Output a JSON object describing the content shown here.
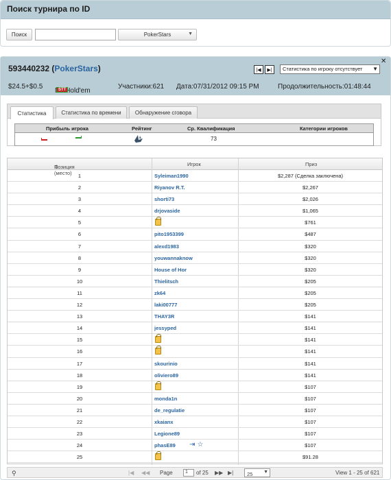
{
  "search": {
    "title": "Поиск турнира по ID",
    "button_label": "Поиск",
    "input_value": "",
    "room_select": "PokerStars"
  },
  "tournament": {
    "id": "593440232",
    "room": "PokerStars",
    "buyin": "$24.5+$0.5",
    "game": "NL Hold'em",
    "game_badge": "STT",
    "participants": "Участники:621",
    "date": "Дата:07/31/2012 09:15 PM",
    "duration": "Продолжительность:01:48:44",
    "stats_select": "Статистика по игроку отсутствует",
    "nav_prev": "|◀",
    "nav_next": "▶|",
    "close": "✕"
  },
  "tabs": [
    "Статистика",
    "Статистика по времени",
    "Обнаружение сговора"
  ],
  "stats": {
    "headers": [
      "Прибыль игрока",
      "Рейтинг",
      "Ср. Квалификация",
      "Категории игроков"
    ],
    "avg_qualification": "73"
  },
  "grid": {
    "headers": {
      "position": "Позиция (место)",
      "sort_icon": "⇕",
      "player": "Игрок",
      "prize": "Приз"
    },
    "rows": [
      {
        "pos": "1",
        "player": "Syleiman1990",
        "prize": "$2,287 (Сделка заключена)"
      },
      {
        "pos": "2",
        "player": "Riyanov R.T.",
        "prize": "$2,267"
      },
      {
        "pos": "3",
        "player": "shorti73",
        "prize": "$2,026"
      },
      {
        "pos": "4",
        "player": "drjovaside",
        "prize": "$1,065"
      },
      {
        "pos": "5",
        "player": "",
        "prize": "$761"
      },
      {
        "pos": "6",
        "player": "pito1953399",
        "prize": "$487"
      },
      {
        "pos": "7",
        "player": "alexd1983",
        "prize": "$320"
      },
      {
        "pos": "8",
        "player": "youwannaknow",
        "prize": "$320"
      },
      {
        "pos": "9",
        "player": "House of Hor",
        "prize": "$320"
      },
      {
        "pos": "10",
        "player": "Thielitsch",
        "prize": "$205"
      },
      {
        "pos": "11",
        "player": "zk64",
        "prize": "$205"
      },
      {
        "pos": "12",
        "player": "laki00777",
        "prize": "$205"
      },
      {
        "pos": "13",
        "player": "THAY3R",
        "prize": "$141"
      },
      {
        "pos": "14",
        "player": "jessyped",
        "prize": "$141"
      },
      {
        "pos": "15",
        "player": "",
        "prize": "$141"
      },
      {
        "pos": "16",
        "player": "",
        "prize": "$141"
      },
      {
        "pos": "17",
        "player": "skourinio",
        "prize": "$141"
      },
      {
        "pos": "18",
        "player": "oliviero89",
        "prize": "$141"
      },
      {
        "pos": "19",
        "player": "",
        "prize": "$107"
      },
      {
        "pos": "20",
        "player": "monda1n",
        "prize": "$107"
      },
      {
        "pos": "21",
        "player": "de_regulatie",
        "prize": "$107"
      },
      {
        "pos": "22",
        "player": "xkaianx",
        "prize": "$107"
      },
      {
        "pos": "23",
        "player": "Legione89",
        "prize": "$107"
      },
      {
        "pos": "24",
        "player": "phasE89",
        "prize": "$107"
      },
      {
        "pos": "25",
        "player": "",
        "prize": "$91.28"
      }
    ]
  },
  "pager": {
    "search_icon": "⚲",
    "first": "|◀",
    "prev": "◀◀",
    "page_label": "Page",
    "page_value": "1",
    "of_label": "of 25",
    "next": "▶▶",
    "last": "▶|",
    "rows_per_page": "25",
    "view_text": "View 1 - 25 of 621"
  }
}
